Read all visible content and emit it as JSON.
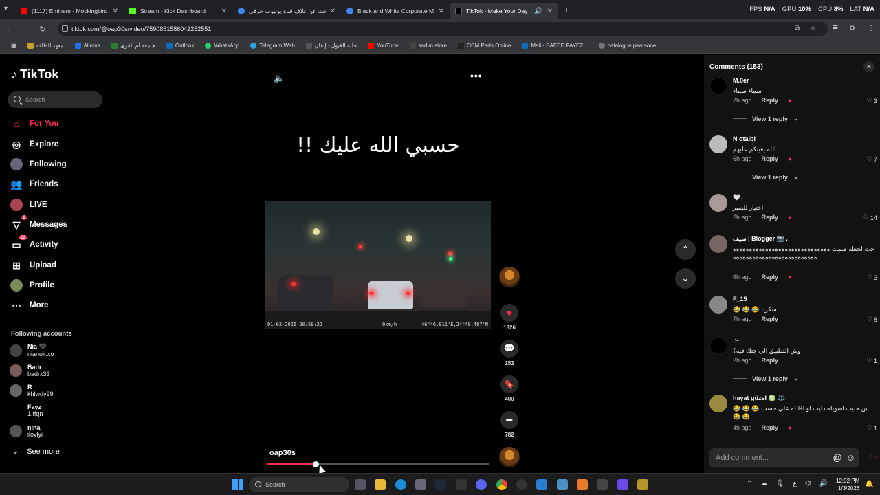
{
  "browser": {
    "tabs": [
      {
        "label": "(1117) Eminem - Mockingbird (",
        "color": "#ff0000"
      },
      {
        "label": "Stream - Kick Dashboard",
        "color": "#53fc18"
      },
      {
        "label": "بحث عن غلاف قناة يوتيوب حرفي",
        "color": "#4285f4"
      },
      {
        "label": "Black and White Corporate M",
        "color": "#4285f4"
      },
      {
        "label": "TikTok - Make Your Day",
        "color": "#000000"
      }
    ],
    "perf": {
      "fps_label": "FPS",
      "fps": "N/A",
      "gpu_label": "GPU",
      "gpu": "10%",
      "cpu_label": "CPU",
      "cpu": "8%",
      "lat_label": "LAT",
      "lat": "N/A"
    },
    "url": "tiktok.com/@oap30s/video/7590851586042252551",
    "bookmarks": [
      "معهد الطاقة",
      "Alinma",
      "جامعة أم القرى",
      "Outlook",
      "WhatsApp",
      "Telegram Web",
      "حالة القبول - إتقان",
      "YouTube",
      "sadim store",
      "OEM Parts Online",
      "Mail - SAEED FAYEZ...",
      "catalogue.pearsone..."
    ]
  },
  "sidebar": {
    "logo": "TikTok",
    "search_placeholder": "Search",
    "nav": [
      {
        "label": "For You",
        "icon": "home-icon"
      },
      {
        "label": "Explore",
        "icon": "compass-icon"
      },
      {
        "label": "Following",
        "icon": "following-icon"
      },
      {
        "label": "Friends",
        "icon": "friends-icon"
      },
      {
        "label": "LIVE",
        "icon": "live-icon"
      },
      {
        "label": "Messages",
        "icon": "messages-icon",
        "badge": "2"
      },
      {
        "label": "Activity",
        "icon": "activity-icon",
        "badge": "22"
      },
      {
        "label": "Upload",
        "icon": "upload-icon"
      },
      {
        "label": "Profile",
        "icon": "profile-icon"
      },
      {
        "label": "More",
        "icon": "more-icon"
      }
    ],
    "following_title": "Following accounts",
    "accounts": [
      {
        "name": "Nia 🖤",
        "user": "nianoir.xo"
      },
      {
        "name": "Badr",
        "user": "badrx33"
      },
      {
        "name": "R",
        "user": "khlwdy99"
      },
      {
        "name": "Fayz",
        "user": "1.ffqn"
      },
      {
        "name": "nina",
        "user": "ilovlyi"
      }
    ],
    "see_more": "See more"
  },
  "video": {
    "caption": "حسبي الله عليك !!",
    "date": "01-02-2026 20:58:22",
    "speed": "0km/h",
    "coords": "46°46.811'E,24°48.487'N",
    "username": "oap30s",
    "progress": 0.22,
    "likes": "1326",
    "comments": "153",
    "saves": "400",
    "shares": "782"
  },
  "comments": {
    "title": "Comments (153)",
    "reply_label": "Reply",
    "add_placeholder": "Add comment...",
    "post_label": "Post",
    "items": [
      {
        "name": "M.0er",
        "text": "سماء سماء",
        "time": "7h ago",
        "likes": "3",
        "view_reply": "View 1 reply"
      },
      {
        "name": "N otaibi",
        "text": "الله يعينكم عليهم",
        "time": "6h ago",
        "likes": "7",
        "view_reply": "View 1 reply"
      },
      {
        "name": "🤍.",
        "text": "اختيار للصبر",
        "time": "2h ago",
        "likes": "14",
        "view_reply": ""
      },
      {
        "name": "سيف | Blogger 📷 .",
        "text": "جت لحظه صمت ةةةةةةةةةةةةةةةةةةةةةةةةةةةةةةةةةةةةةةةةةةةةةةةةةةةةةةةة",
        "time": "6h ago",
        "likes": "3",
        "view_reply": ""
      },
      {
        "name": "F_15",
        "text": "سكرتا 😂 😂 😂",
        "time": "7h ago",
        "likes": "8",
        "view_reply": ""
      },
      {
        "name": ".:-",
        "text": "وش التطبيق الي جتك فيه؟",
        "time": "2h ago",
        "likes": "1",
        "view_reply": "View 1 reply"
      },
      {
        "name": "hayat güzel ♍️ ⚖️",
        "text": "بس حبيت اسويله دليت او اقابله علي حسب 😂 😂 😂 😂 😂",
        "time": "4h ago",
        "likes": "1",
        "view_reply": ""
      }
    ]
  },
  "taskbar": {
    "search_placeholder": "Search",
    "time": "12:02 PM",
    "date": "1/3/2026"
  }
}
